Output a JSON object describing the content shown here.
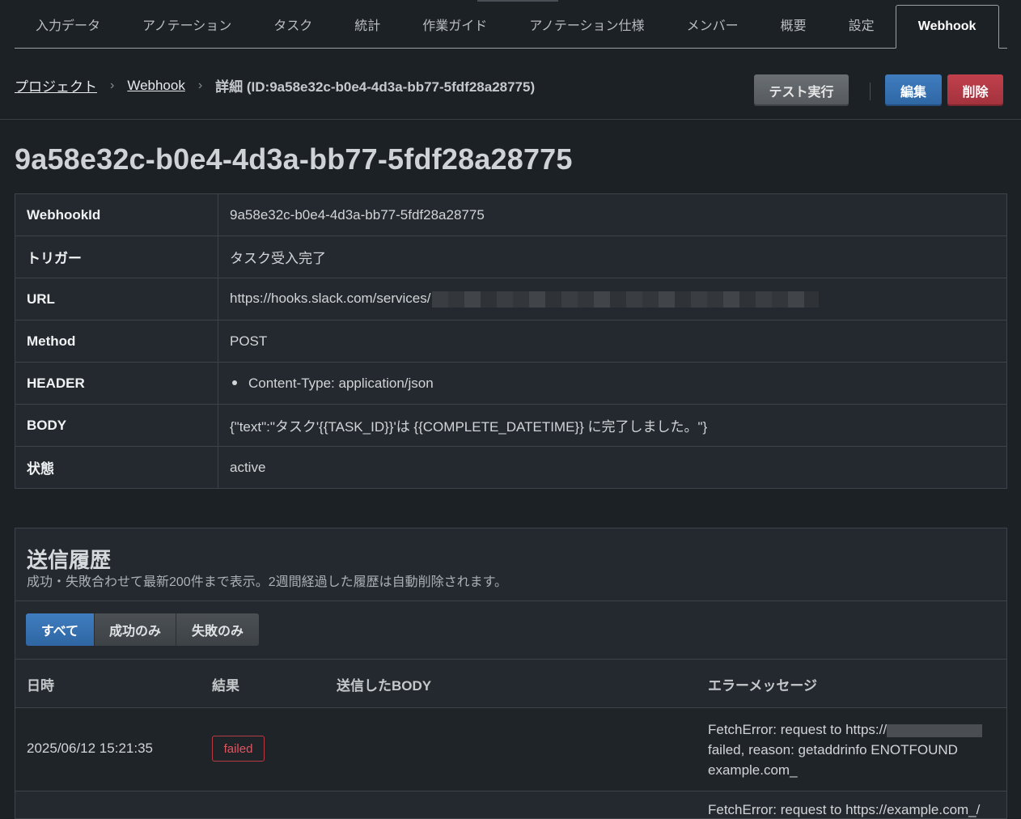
{
  "tabs": [
    "入力データ",
    "アノテーション",
    "タスク",
    "統計",
    "作業ガイド",
    "アノテーション仕様",
    "メンバー",
    "概要",
    "設定",
    "Webhook"
  ],
  "breadcrumb": {
    "project": "プロジェクト",
    "webhook": "Webhook",
    "current": "詳細 (ID:9a58e32c-b0e4-4d3a-bb77-5fdf28a28775)"
  },
  "actions": {
    "test": "テスト実行",
    "edit": "編集",
    "delete": "削除"
  },
  "title": "9a58e32c-b0e4-4d3a-bb77-5fdf28a28775",
  "info": {
    "webhook_id": {
      "label": "WebhookId",
      "value": "9a58e32c-b0e4-4d3a-bb77-5fdf28a28775"
    },
    "trigger": {
      "label": "トリガー",
      "value": "タスク受入完了"
    },
    "url": {
      "label": "URL",
      "value": "https://hooks.slack.com/services/"
    },
    "method": {
      "label": "Method",
      "value": "POST"
    },
    "header": {
      "label": "HEADER",
      "value": "Content-Type: application/json"
    },
    "body": {
      "label": "BODY",
      "value": "{\"text\":\"タスク'{{TASK_ID}}'は {{COMPLETE_DATETIME}} に完了しました。\"}"
    },
    "status": {
      "label": "状態",
      "value": "active"
    }
  },
  "history": {
    "title": "送信履歴",
    "subtitle": "成功・失敗合わせて最新200件まで表示。2週間経過した履歴は自動削除されます。",
    "filters": [
      "すべて",
      "成功のみ",
      "失敗のみ"
    ],
    "columns": [
      "日時",
      "結果",
      "送信したBODY",
      "エラーメッセージ"
    ],
    "rows": [
      {
        "datetime": "2025/06/12 15:21:35",
        "result": "failed",
        "body": "",
        "error_prefix": "FetchError: request to https://",
        "error_rest": "failed, reason: getaddrinfo ENOTFOUND example.com_"
      }
    ],
    "next_row_error": "FetchError: request to https://example.com_/"
  }
}
